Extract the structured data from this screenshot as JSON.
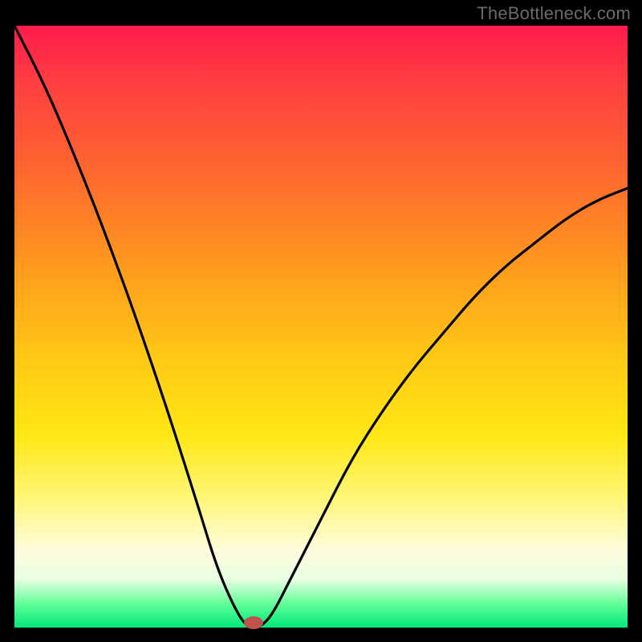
{
  "watermark": "TheBottleneck.com",
  "chart_data": {
    "type": "line",
    "title": "",
    "xlabel": "",
    "ylabel": "",
    "xlim": [
      0,
      100
    ],
    "ylim": [
      0,
      100
    ],
    "background": "rainbow-gradient-red-to-green",
    "series": [
      {
        "name": "bottleneck-curve",
        "x": [
          0,
          5,
          10,
          15,
          20,
          25,
          30,
          33,
          36,
          38,
          40,
          42,
          45,
          50,
          55,
          60,
          65,
          70,
          75,
          80,
          85,
          90,
          95,
          100
        ],
        "y": [
          100,
          90,
          78,
          65,
          51,
          36,
          20,
          10,
          3,
          0,
          0,
          2,
          8,
          18,
          28,
          36,
          43,
          49,
          55,
          60,
          64,
          68,
          71,
          73
        ]
      }
    ],
    "optimum_marker": {
      "x": 39,
      "y": 0
    },
    "colors": {
      "curve": "#000000",
      "marker": "#c0524c",
      "gradient_top": "#ff1b4b",
      "gradient_bottom": "#00e879"
    }
  }
}
